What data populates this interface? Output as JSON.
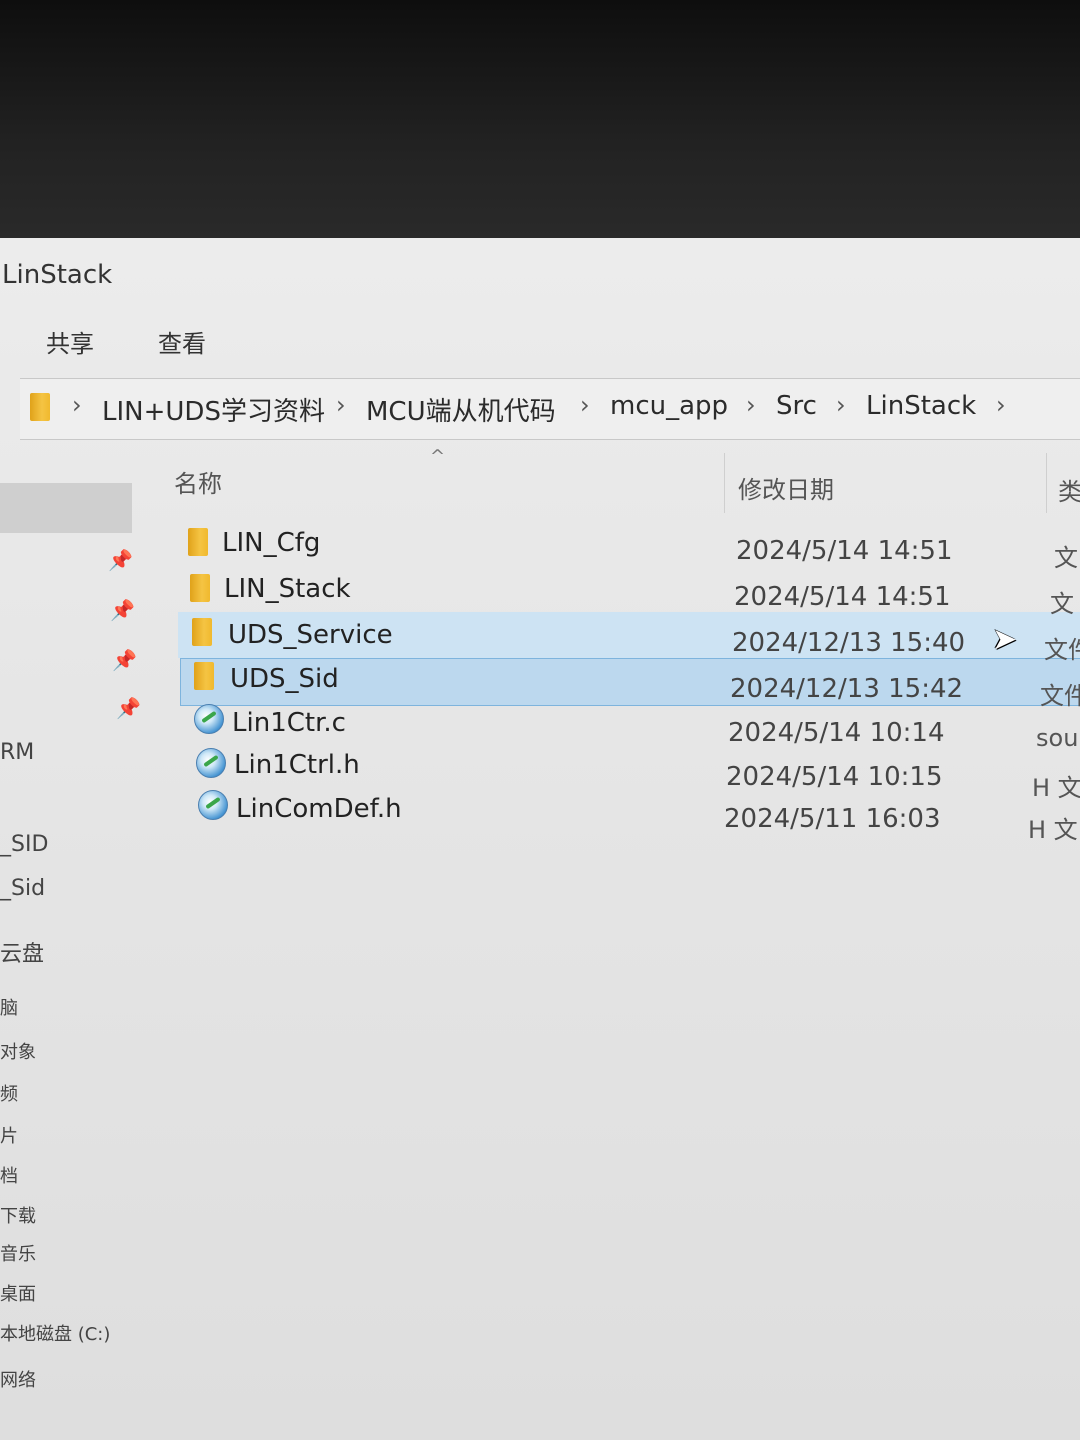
{
  "window": {
    "title": "LinStack"
  },
  "ribbon": {
    "tabs": [
      "共享",
      "查看"
    ]
  },
  "breadcrumb": {
    "items": [
      "LIN+UDS学习资料",
      "MCU端从机代码",
      "mcu_app",
      "Src",
      "LinStack"
    ],
    "separator": "›"
  },
  "columns": {
    "name": "名称",
    "modified": "修改日期",
    "type": "类"
  },
  "nav": {
    "items": [
      "RM",
      "_SID",
      "_Sid",
      "云盘",
      "脑",
      "对象",
      "频",
      "片",
      "档",
      "下载",
      "音乐",
      "桌面",
      "本地磁盘 (C:)",
      "网络"
    ]
  },
  "files": [
    {
      "name": "LIN_Cfg",
      "modified": "2024/5/14 14:51",
      "type": "文",
      "icon": "folder-icon"
    },
    {
      "name": "LIN_Stack",
      "modified": "2024/5/14 14:51",
      "type": "文",
      "icon": "folder-icon"
    },
    {
      "name": "UDS_Service",
      "modified": "2024/12/13 15:40",
      "type": "文件",
      "icon": "folder-icon",
      "state": "hover"
    },
    {
      "name": "UDS_Sid",
      "modified": "2024/12/13 15:42",
      "type": "文件",
      "icon": "folder-icon",
      "state": "selected"
    },
    {
      "name": "Lin1Ctr.c",
      "modified": "2024/5/14 10:14",
      "type": "sou",
      "icon": "source-file-icon"
    },
    {
      "name": "Lin1Ctrl.h",
      "modified": "2024/5/14 10:15",
      "type": "H 文",
      "icon": "source-file-icon"
    },
    {
      "name": "LinComDef.h",
      "modified": "2024/5/11 16:03",
      "type": "H 文",
      "icon": "source-file-icon"
    }
  ],
  "colors": {
    "selected_bg": "#bcd8ee",
    "hover_bg": "#cde3f3",
    "folder": "#f0b92e"
  }
}
